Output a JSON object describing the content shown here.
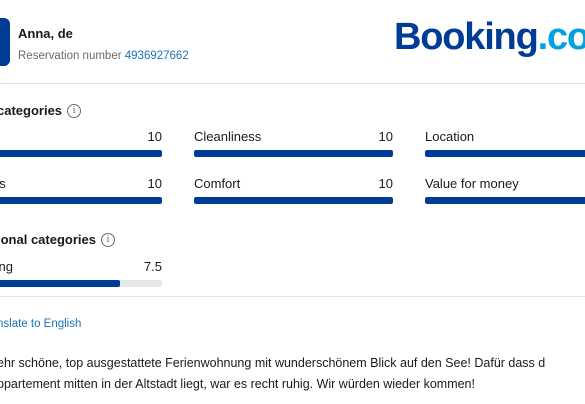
{
  "header": {
    "guest_name": "Anna, de",
    "reservation_label": "Reservation number",
    "reservation_number": "4936927662",
    "logo": {
      "part1": "Booking",
      "part2": ".com"
    }
  },
  "categories": {
    "title": "categories",
    "items": [
      {
        "label": "",
        "value": "10",
        "fraction": 1.0
      },
      {
        "label": "Cleanliness",
        "value": "10",
        "fraction": 1.0
      },
      {
        "label": "Location",
        "value": "",
        "fraction": 1.0
      },
      {
        "label": "es",
        "value": "10",
        "fraction": 1.0
      },
      {
        "label": "Comfort",
        "value": "10",
        "fraction": 1.0
      },
      {
        "label": "Value for money",
        "value": "",
        "fraction": 1.0
      }
    ]
  },
  "additional": {
    "title": "ional categories",
    "items": [
      {
        "label": "ting",
        "value": "7.5",
        "fraction": 0.75
      }
    ]
  },
  "translate_link": "nslate to English",
  "review": {
    "line1": "ehr schöne, top ausgestattete Ferienwohnung mit wunderschönem Blick auf den See! Dafür dass d",
    "line2": "ppartement mitten in der Altstadt liegt, war es recht ruhig. Wir würden wieder kommen!"
  },
  "colors": {
    "bar_fill": "#003b95",
    "bar_track": "#e8e8e8",
    "link": "#1a73b8",
    "logo_primary": "#003b95",
    "logo_accent": "#00a2e0"
  }
}
